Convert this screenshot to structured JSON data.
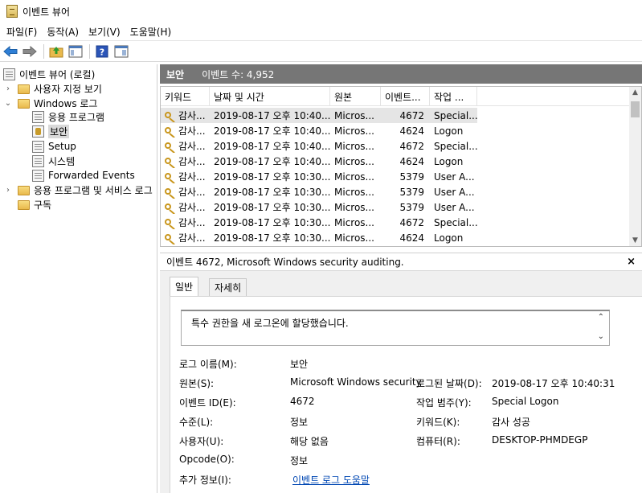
{
  "window": {
    "title": "이벤트 뷰어"
  },
  "menu": [
    "파일(F)",
    "동작(A)",
    "보기(V)",
    "도움말(H)"
  ],
  "toolbar": {
    "buttons": [
      "back-arrow-icon",
      "forward-arrow-icon",
      "up-folder-icon",
      "show-hide-tree-icon",
      "help-icon",
      "properties-pane-icon"
    ]
  },
  "tree": {
    "root": "이벤트 뷰어 (로컬)",
    "custom_views": "사용자 지정 보기",
    "windows_logs": "Windows 로그",
    "logs": [
      "응용 프로그램",
      "보안",
      "Setup",
      "시스템",
      "Forwarded Events"
    ],
    "app_services": "응용 프로그램 및 서비스 로그",
    "subscriptions": "구독"
  },
  "header": {
    "title": "보안",
    "count_label": "이벤트 수: 4,952"
  },
  "columns": [
    "키워드",
    "날짜 및 시간",
    "원본",
    "이벤트...",
    "작업 ..."
  ],
  "events": [
    {
      "keyword": "감사...",
      "datetime": "2019-08-17 오후 10:40...",
      "source": "Micros...",
      "id": "4672",
      "task": "Special..."
    },
    {
      "keyword": "감사...",
      "datetime": "2019-08-17 오후 10:40...",
      "source": "Micros...",
      "id": "4624",
      "task": "Logon"
    },
    {
      "keyword": "감사...",
      "datetime": "2019-08-17 오후 10:40...",
      "source": "Micros...",
      "id": "4672",
      "task": "Special..."
    },
    {
      "keyword": "감사...",
      "datetime": "2019-08-17 오후 10:40...",
      "source": "Micros...",
      "id": "4624",
      "task": "Logon"
    },
    {
      "keyword": "감사...",
      "datetime": "2019-08-17 오후 10:30...",
      "source": "Micros...",
      "id": "5379",
      "task": "User A..."
    },
    {
      "keyword": "감사...",
      "datetime": "2019-08-17 오후 10:30...",
      "source": "Micros...",
      "id": "5379",
      "task": "User A..."
    },
    {
      "keyword": "감사...",
      "datetime": "2019-08-17 오후 10:30...",
      "source": "Micros...",
      "id": "5379",
      "task": "User A..."
    },
    {
      "keyword": "감사...",
      "datetime": "2019-08-17 오후 10:30...",
      "source": "Micros...",
      "id": "4672",
      "task": "Special..."
    },
    {
      "keyword": "감사...",
      "datetime": "2019-08-17 오후 10:30...",
      "source": "Micros...",
      "id": "4624",
      "task": "Logon"
    }
  ],
  "detail": {
    "title": "이벤트 4672, Microsoft Windows security auditing.",
    "close": "×",
    "tabs": [
      "일반",
      "자세히"
    ],
    "description": "특수 권한을 새 로그온에 할당했습니다.",
    "props": {
      "log_name_label": "로그 이름(M):",
      "log_name": "보안",
      "source_label": "원본(S):",
      "source": "Microsoft Windows security",
      "logged_label": "로그된 날짜(D):",
      "logged": "2019-08-17 오후 10:40:31",
      "event_id_label": "이벤트 ID(E):",
      "event_id": "4672",
      "task_category_label": "작업 범주(Y):",
      "task_category": "Special Logon",
      "level_label": "수준(L):",
      "level": "정보",
      "keywords_label": "키워드(K):",
      "keywords": "감사 성공",
      "user_label": "사용자(U):",
      "user": "해당 없음",
      "computer_label": "컴퓨터(R):",
      "computer": "DESKTOP-PHMDEGP",
      "opcode_label": "Opcode(O):",
      "opcode": "정보",
      "more_info_label": "추가 정보(I):",
      "more_info_link": "이벤트 로그 도움말"
    }
  },
  "colors": {
    "header_bg": "#767676",
    "selected_row": "#e5e5e5",
    "link": "#0047b3",
    "detail_bg": "#f0f0f0"
  }
}
